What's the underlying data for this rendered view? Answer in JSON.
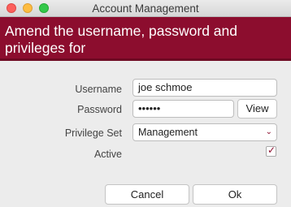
{
  "window": {
    "title": "Account Management"
  },
  "banner": {
    "heading": "Amend the username, password and privileges for"
  },
  "form": {
    "username_label": "Username",
    "username_value": "joe schmoe",
    "password_label": "Password",
    "password_value": "••••••",
    "view_label": "View",
    "privilege_label": "Privilege Set",
    "privilege_value": "Management",
    "active_label": "Active",
    "active_checked": true
  },
  "buttons": {
    "cancel": "Cancel",
    "ok": "Ok"
  },
  "colors": {
    "banner": "#8c0d2e",
    "close": "#fc605c",
    "minimize": "#fdbc40",
    "maximize": "#34c84a"
  }
}
